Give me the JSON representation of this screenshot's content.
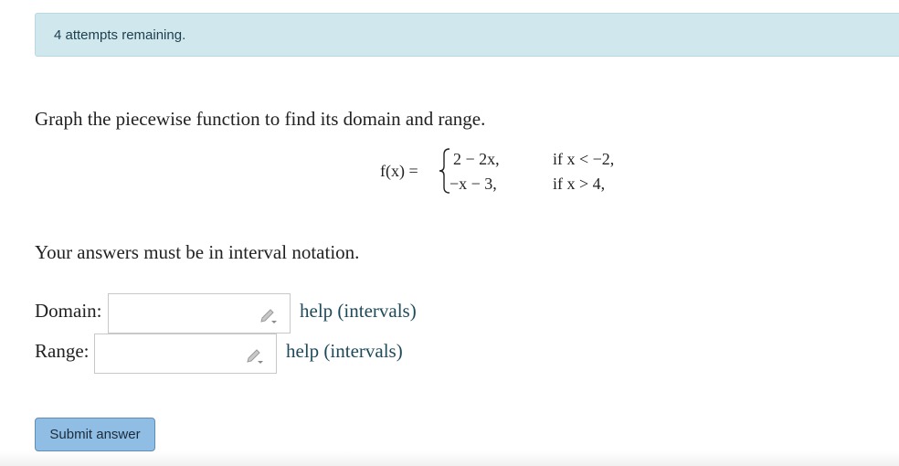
{
  "alert": {
    "text": "4 attempts remaining."
  },
  "problem": {
    "prompt": "Graph the piecewise function to find its domain and range.",
    "function_label": "f(x) =",
    "cases": [
      {
        "expr": "2 − 2x,",
        "cond": "if x < −2,"
      },
      {
        "expr": "−x − 3,",
        "cond": "if x > 4,"
      }
    ],
    "note": "Your answers must be in interval notation."
  },
  "domain": {
    "label": "Domain:",
    "value": "",
    "help": "help (intervals)"
  },
  "range": {
    "label": "Range:",
    "value": "",
    "help": "help (intervals)"
  },
  "submit": {
    "label": "Submit answer"
  },
  "icons": {
    "edit": "pencil-icon"
  },
  "colors": {
    "alert_bg": "#d1e7ee",
    "button_bg": "#8fbde4",
    "link": "#1e4a5a"
  }
}
